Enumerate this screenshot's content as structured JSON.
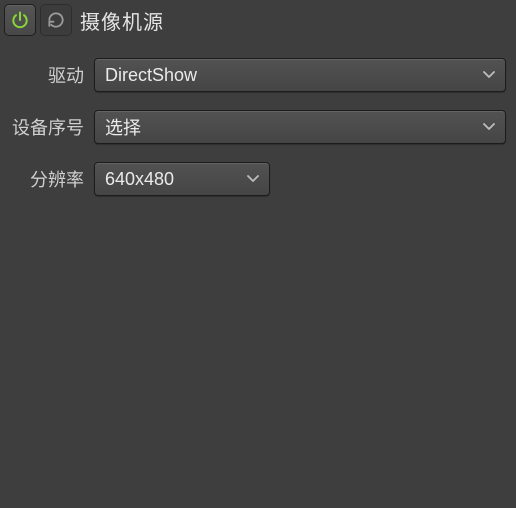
{
  "header": {
    "title": "摄像机源"
  },
  "form": {
    "driver": {
      "label": "驱动",
      "value": "DirectShow"
    },
    "device": {
      "label": "设备序号",
      "value": "选择"
    },
    "resolution": {
      "label": "分辨率",
      "value": "640x480"
    }
  },
  "colors": {
    "power_active": "#89d639"
  }
}
